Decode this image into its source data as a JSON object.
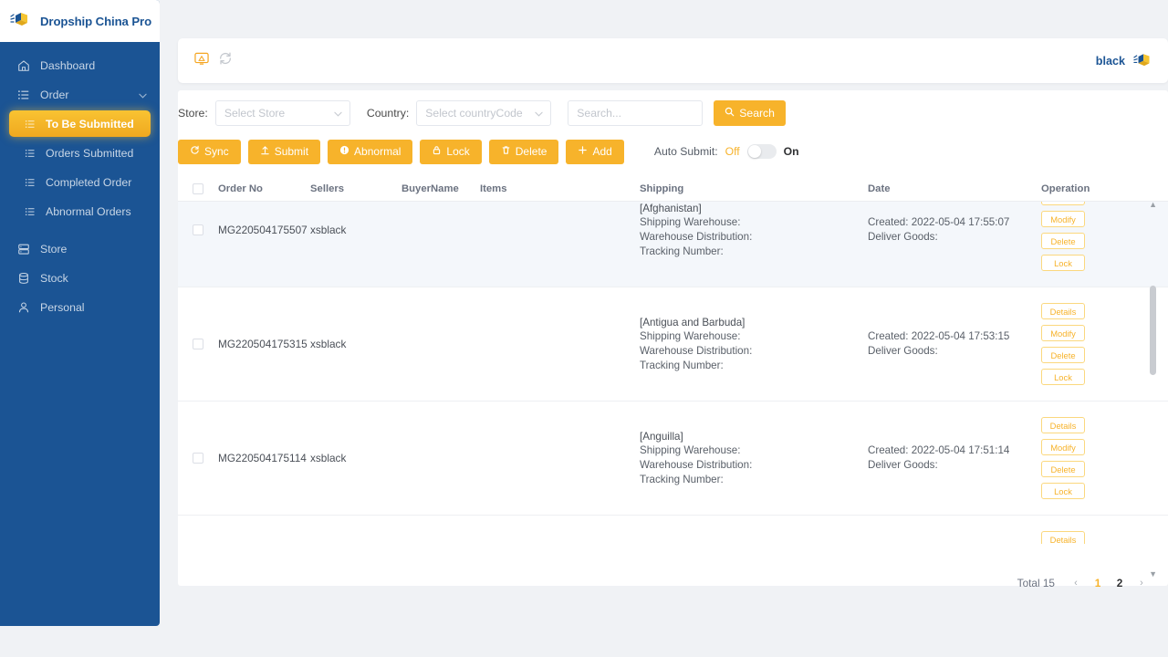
{
  "brand": {
    "name": "Dropship China Pro",
    "logo_icon": "package-box-icon",
    "color": "#1b5494"
  },
  "sidebar": {
    "bg_color": "#1b5494",
    "active_color": "#f7b32b",
    "items": [
      {
        "label": "Dashboard",
        "icon": "home-icon",
        "level": 0,
        "active": false
      },
      {
        "label": "Order",
        "icon": "list-icon",
        "level": 0,
        "active": false,
        "expanded": true
      },
      {
        "label": "To Be Submitted",
        "icon": "list-small-icon",
        "level": 1,
        "active": true
      },
      {
        "label": "Orders Submitted",
        "icon": "list-small-icon",
        "level": 1,
        "active": false
      },
      {
        "label": "Completed Order",
        "icon": "list-small-icon",
        "level": 1,
        "active": false
      },
      {
        "label": "Abnormal Orders",
        "icon": "list-small-icon",
        "level": 1,
        "active": false
      },
      {
        "label": "Store",
        "icon": "store-icon",
        "level": 0,
        "active": false
      },
      {
        "label": "Stock",
        "icon": "database-icon",
        "level": 0,
        "active": false
      },
      {
        "label": "Personal",
        "icon": "user-icon",
        "level": 0,
        "active": false
      }
    ]
  },
  "topbar": {
    "left_icons": [
      {
        "name": "screen-cast-icon",
        "color": "#f5a623"
      },
      {
        "name": "refresh-icon",
        "color": "#c5c9cf"
      }
    ],
    "user_name": "black",
    "avatar_icon": "package-box-icon"
  },
  "filters": {
    "store_label": "Store:",
    "store_placeholder": "Select Store",
    "country_label": "Country:",
    "country_placeholder": "Select countryCode",
    "search_placeholder": "Search...",
    "search_button": "Search",
    "search_icon": "search-icon"
  },
  "actions": {
    "buttons": [
      {
        "label": "Sync",
        "icon": "refresh-icon"
      },
      {
        "label": "Submit",
        "icon": "upload-icon"
      },
      {
        "label": "Abnormal",
        "icon": "alert-icon"
      },
      {
        "label": "Lock",
        "icon": "lock-icon"
      },
      {
        "label": "Delete",
        "icon": "trash-icon"
      },
      {
        "label": "Add",
        "icon": "plus-icon"
      }
    ],
    "auto_submit_label": "Auto Submit:",
    "auto_submit_off": "Off",
    "auto_submit_on": "On",
    "auto_submit_state": "Off"
  },
  "table": {
    "columns": [
      "Order No",
      "Sellers",
      "BuyerName",
      "Items",
      "Shipping",
      "Date",
      "Operation"
    ],
    "labels": {
      "shipping_warehouse": "Shipping Warehouse:",
      "warehouse_distribution": "Warehouse Distribution:",
      "tracking_number": "Tracking Number:",
      "created": "Created:",
      "deliver_goods": "Deliver Goods:"
    },
    "op_buttons": [
      "Details",
      "Modify",
      "Delete",
      "Lock"
    ],
    "rows": [
      {
        "order_no": "MG220504175507",
        "seller": "xsblack",
        "buyer": "",
        "items": "",
        "country": "[Afghanistan]",
        "shipping_warehouse": "",
        "warehouse_distribution": "",
        "tracking_number": "",
        "created": "2022-05-04 17:55:07",
        "deliver_goods": "",
        "highlighted": true
      },
      {
        "order_no": "MG220504175315",
        "seller": "xsblack",
        "buyer": "",
        "items": "",
        "country": "[Antigua and Barbuda]",
        "shipping_warehouse": "",
        "warehouse_distribution": "",
        "tracking_number": "",
        "created": "2022-05-04 17:53:15",
        "deliver_goods": "",
        "highlighted": false
      },
      {
        "order_no": "MG220504175114",
        "seller": "xsblack",
        "buyer": "",
        "items": "",
        "country": "[Anguilla]",
        "shipping_warehouse": "",
        "warehouse_distribution": "",
        "tracking_number": "",
        "created": "2022-05-04 17:51:14",
        "deliver_goods": "",
        "highlighted": false
      }
    ]
  },
  "pagination": {
    "total_label": "Total 15",
    "prev": "‹",
    "next": "›",
    "pages": [
      "1",
      "2"
    ],
    "current": "1"
  }
}
